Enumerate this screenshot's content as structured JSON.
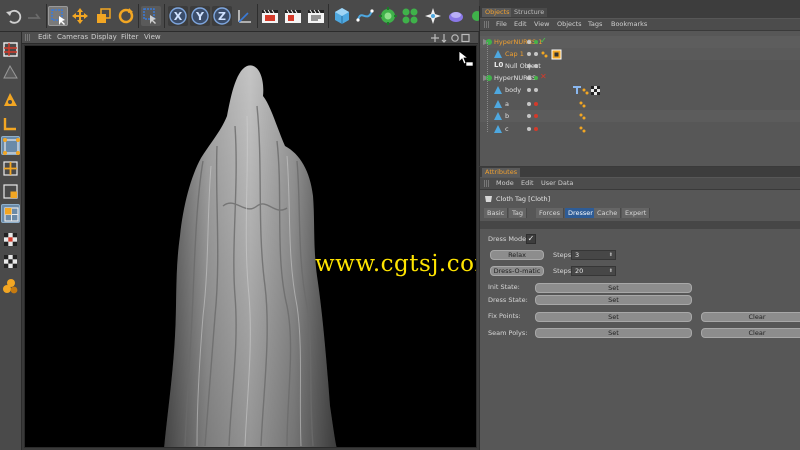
{
  "toolbar": {
    "buttons": [
      "undo-icon",
      "redo-icon",
      "select-icon",
      "move-icon",
      "scale-icon",
      "rotate-icon",
      "recent-tool-icon",
      "x-axis-icon",
      "y-axis-icon",
      "z-axis-icon",
      "world-coords-icon",
      "render-view-icon",
      "render-picture-viewer-icon",
      "render-settings-icon",
      "cube-icon",
      "spline-icon",
      "nurbs-icon",
      "array-icon",
      "deformer-icon",
      "scene-icon",
      "camera-icon"
    ],
    "axes": [
      "X",
      "Y",
      "Z"
    ]
  },
  "viewport": {
    "menu": [
      "Edit",
      "Cameras",
      "Display",
      "Filter",
      "View"
    ]
  },
  "watermark": "www.cgtsj.com",
  "objects_panel": {
    "tabs": [
      "Objects",
      "Structure"
    ],
    "menu": [
      "File",
      "Edit",
      "View",
      "Objects",
      "Tags",
      "Bookmarks"
    ],
    "rows": [
      {
        "name": "HyperNURBS.1",
        "selected": true
      },
      {
        "name": "Cap 1",
        "selected": true
      },
      {
        "name": "Null Object",
        "selected": false
      },
      {
        "name": "HyperNURBS",
        "selected": false
      },
      {
        "name": "body",
        "selected": false
      },
      {
        "name": "a",
        "selected": false
      },
      {
        "name": "b",
        "selected": false
      },
      {
        "name": "c",
        "selected": false
      }
    ]
  },
  "attributes_panel": {
    "tab": "Attributes",
    "menu": [
      "Mode",
      "Edit",
      "User Data"
    ],
    "tag_title": "Cloth Tag [Cloth]",
    "tabs": [
      "Basic",
      "Tag",
      "Forces",
      "Dresser",
      "Cache",
      "Expert"
    ],
    "active_tab": "Dresser",
    "dress_mode_label": "Dress Mode",
    "dress_mode_checked": true,
    "relax_label": "Relax",
    "relax_steps_label": "Steps",
    "relax_steps_value": "3",
    "dressomatic_label": "Dress-O-matic",
    "dressomatic_steps_label": "Steps",
    "dressomatic_steps_value": "20",
    "init_state_label": "Init State:",
    "dress_state_label": "Dress State:",
    "fix_points_label": "Fix Points:",
    "seam_polys_label": "Seam Polys:",
    "set_label": "Set",
    "clear_label": "Clear"
  },
  "colors": {
    "selected_text": "#f0a030",
    "active_tab": "#2e5c96",
    "watermark": "#ffe400"
  }
}
